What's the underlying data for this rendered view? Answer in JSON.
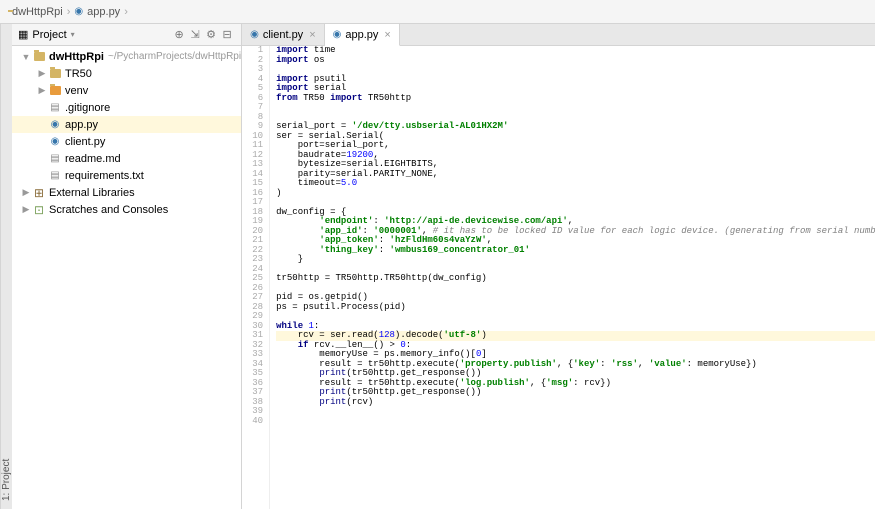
{
  "breadcrumb": {
    "root": "dwHttpRpi",
    "file": "app.py"
  },
  "project_panel": {
    "title": "Project",
    "items": [
      {
        "label": "dwHttpRpi",
        "path": "~/PycharmProjects/dwHttpRpi",
        "depth": 0,
        "type": "root",
        "expanded": true,
        "bold": true
      },
      {
        "label": "TR50",
        "depth": 1,
        "type": "folder",
        "expanded": false
      },
      {
        "label": "venv",
        "depth": 1,
        "type": "folder-excl",
        "expanded": false
      },
      {
        "label": ".gitignore",
        "depth": 1,
        "type": "file"
      },
      {
        "label": "app.py",
        "depth": 1,
        "type": "py",
        "selected": true
      },
      {
        "label": "client.py",
        "depth": 1,
        "type": "py"
      },
      {
        "label": "readme.md",
        "depth": 1,
        "type": "md"
      },
      {
        "label": "requirements.txt",
        "depth": 1,
        "type": "txt"
      },
      {
        "label": "External Libraries",
        "depth": 0,
        "type": "lib",
        "expanded": false
      },
      {
        "label": "Scratches and Consoles",
        "depth": 0,
        "type": "scratch",
        "expanded": false
      }
    ]
  },
  "side_label": "1: Project",
  "tabs": [
    {
      "label": "client.py",
      "type": "py",
      "active": false
    },
    {
      "label": "app.py",
      "type": "py",
      "active": true
    }
  ],
  "code_lines": [
    {
      "n": 1,
      "tokens": [
        [
          "kw",
          "import"
        ],
        [
          "fn",
          " time"
        ]
      ]
    },
    {
      "n": 2,
      "tokens": [
        [
          "kw",
          "import"
        ],
        [
          "fn",
          " os"
        ]
      ]
    },
    {
      "n": 3,
      "tokens": []
    },
    {
      "n": 4,
      "tokens": [
        [
          "kw",
          "import"
        ],
        [
          "fn",
          " psutil"
        ]
      ]
    },
    {
      "n": 5,
      "tokens": [
        [
          "kw",
          "import"
        ],
        [
          "fn",
          " serial"
        ]
      ]
    },
    {
      "n": 6,
      "tokens": [
        [
          "kw",
          "from"
        ],
        [
          "fn",
          " TR50 "
        ],
        [
          "kw",
          "import"
        ],
        [
          "fn",
          " TR50http"
        ]
      ]
    },
    {
      "n": 7,
      "tokens": []
    },
    {
      "n": 8,
      "tokens": []
    },
    {
      "n": 9,
      "tokens": [
        [
          "fn",
          "serial_port = "
        ],
        [
          "str",
          "'/dev/tty.usbserial-AL01HX2M'"
        ]
      ]
    },
    {
      "n": 10,
      "tokens": [
        [
          "fn",
          "ser = serial.Serial("
        ]
      ]
    },
    {
      "n": 11,
      "tokens": [
        [
          "fn",
          "    port=serial_port,"
        ]
      ]
    },
    {
      "n": 12,
      "tokens": [
        [
          "fn",
          "    baudrate="
        ],
        [
          "num",
          "19200"
        ],
        [
          "fn",
          ","
        ]
      ]
    },
    {
      "n": 13,
      "tokens": [
        [
          "fn",
          "    bytesize=serial.EIGHTBITS,"
        ]
      ]
    },
    {
      "n": 14,
      "tokens": [
        [
          "fn",
          "    parity=serial.PARITY_NONE,"
        ]
      ]
    },
    {
      "n": 15,
      "tokens": [
        [
          "fn",
          "    timeout="
        ],
        [
          "num",
          "5.0"
        ]
      ]
    },
    {
      "n": 16,
      "tokens": [
        [
          "fn",
          ")"
        ]
      ]
    },
    {
      "n": 17,
      "tokens": []
    },
    {
      "n": 18,
      "tokens": [
        [
          "fn",
          "dw_config = {"
        ]
      ]
    },
    {
      "n": 19,
      "tokens": [
        [
          "fn",
          "        "
        ],
        [
          "str",
          "'endpoint'"
        ],
        [
          "fn",
          ": "
        ],
        [
          "str",
          "'http://api-de.devicewise.com/api'"
        ],
        [
          "fn",
          ","
        ]
      ]
    },
    {
      "n": 20,
      "tokens": [
        [
          "fn",
          "        "
        ],
        [
          "str",
          "'app_id'"
        ],
        [
          "fn",
          ": "
        ],
        [
          "str",
          "'0000001'"
        ],
        [
          "fn",
          ", "
        ],
        [
          "com",
          "# it has to be locked ID value for each logic device. (generating from serial numbers?)"
        ]
      ]
    },
    {
      "n": 21,
      "tokens": [
        [
          "fn",
          "        "
        ],
        [
          "str",
          "'app_token'"
        ],
        [
          "fn",
          ": "
        ],
        [
          "str",
          "'hzFldHm60s4vaYzW'"
        ],
        [
          "fn",
          ","
        ]
      ]
    },
    {
      "n": 22,
      "tokens": [
        [
          "fn",
          "        "
        ],
        [
          "str",
          "'thing_key'"
        ],
        [
          "fn",
          ": "
        ],
        [
          "str",
          "'wmbus169_concentrator_01'"
        ]
      ]
    },
    {
      "n": 23,
      "tokens": [
        [
          "fn",
          "    }"
        ]
      ]
    },
    {
      "n": 24,
      "tokens": []
    },
    {
      "n": 25,
      "tokens": [
        [
          "fn",
          "tr50http = TR50http.TR50http(dw_config)"
        ]
      ]
    },
    {
      "n": 26,
      "tokens": []
    },
    {
      "n": 27,
      "tokens": [
        [
          "fn",
          "pid = os.getpid()"
        ]
      ]
    },
    {
      "n": 28,
      "tokens": [
        [
          "fn",
          "ps = psutil.Process(pid)"
        ]
      ]
    },
    {
      "n": 29,
      "tokens": []
    },
    {
      "n": 30,
      "tokens": [
        [
          "kw",
          "while "
        ],
        [
          "num",
          "1"
        ],
        [
          "fn",
          ":"
        ]
      ]
    },
    {
      "n": 31,
      "hl": true,
      "tokens": [
        [
          "fn",
          "    rcv = ser.read("
        ],
        [
          "num",
          "128"
        ],
        [
          "fn",
          ").decode("
        ],
        [
          "str",
          "'utf-8'"
        ],
        [
          "fn",
          ")"
        ]
      ]
    },
    {
      "n": 32,
      "tokens": [
        [
          "fn",
          "    "
        ],
        [
          "kw",
          "if"
        ],
        [
          "fn",
          " rcv.__len__() > "
        ],
        [
          "num",
          "0"
        ],
        [
          "fn",
          ":"
        ]
      ]
    },
    {
      "n": 33,
      "tokens": [
        [
          "fn",
          "        memoryUse = ps.memory_info()["
        ],
        [
          "num",
          "0"
        ],
        [
          "fn",
          "]"
        ]
      ]
    },
    {
      "n": 34,
      "tokens": [
        [
          "fn",
          "        result = tr50http.execute("
        ],
        [
          "str",
          "'property.publish'"
        ],
        [
          "fn",
          ", {"
        ],
        [
          "str",
          "'key'"
        ],
        [
          "fn",
          ": "
        ],
        [
          "str",
          "'rss'"
        ],
        [
          "fn",
          ", "
        ],
        [
          "str",
          "'value'"
        ],
        [
          "fn",
          ": memoryUse})"
        ]
      ]
    },
    {
      "n": 35,
      "tokens": [
        [
          "fn",
          "        "
        ],
        [
          "bif",
          "print"
        ],
        [
          "fn",
          "(tr50http.get_response())"
        ]
      ]
    },
    {
      "n": 36,
      "tokens": [
        [
          "fn",
          "        result = tr50http.execute("
        ],
        [
          "str",
          "'log.publish'"
        ],
        [
          "fn",
          ", {"
        ],
        [
          "str",
          "'msg'"
        ],
        [
          "fn",
          ": rcv})"
        ]
      ]
    },
    {
      "n": 37,
      "tokens": [
        [
          "fn",
          "        "
        ],
        [
          "bif",
          "print"
        ],
        [
          "fn",
          "(tr50http.get_response())"
        ]
      ]
    },
    {
      "n": 38,
      "tokens": [
        [
          "fn",
          "        "
        ],
        [
          "bif",
          "print"
        ],
        [
          "fn",
          "(rcv)"
        ]
      ]
    },
    {
      "n": 39,
      "tokens": []
    },
    {
      "n": 40,
      "tokens": []
    }
  ]
}
